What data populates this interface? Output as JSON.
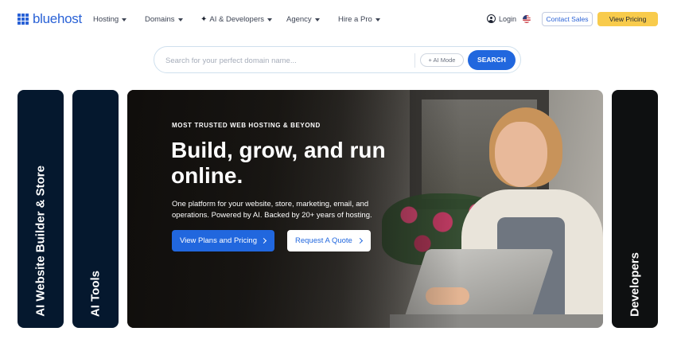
{
  "header": {
    "logo_text": "bluehost",
    "nav": [
      {
        "label": "Hosting"
      },
      {
        "label": "Domains"
      },
      {
        "label": "AI & Developers"
      },
      {
        "label": "Agency"
      },
      {
        "label": "Hire a Pro"
      }
    ],
    "login_label": "Login",
    "contact_label": "Contact Sales",
    "pricing_label": "View Pricing"
  },
  "search": {
    "placeholder": "Search for your perfect domain name...",
    "ai_mode_label": "+ AI Mode",
    "button_label": "SEARCH"
  },
  "panels": {
    "left1": "AI Website Builder & Store",
    "left2": "AI Tools",
    "right": "Developers"
  },
  "hero": {
    "eyebrow": "MOST TRUSTED WEB HOSTING & BEYOND",
    "headline": "Build, grow, and run online.",
    "subtext": "One platform for your website, store, marketing, email, and operations. Powered by AI. Backed by 20+ years of hosting.",
    "primary_button": "View Plans and Pricing",
    "secondary_button": "Request A Quote"
  },
  "colors": {
    "brand_blue": "#2167de",
    "accent_yellow": "#f8cb4c",
    "panel_navy": "#05182e"
  }
}
